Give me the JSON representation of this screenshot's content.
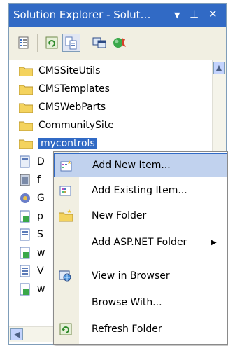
{
  "titlebar": {
    "title": "Solution Explorer - Solut…",
    "dropdown": "▼",
    "pin": "⊥",
    "close": "✕"
  },
  "toolbar": {
    "buttons": [
      "properties-icon",
      "refresh-icon",
      "show-all-files-icon",
      "copy-website-icon",
      "asp-config-icon"
    ]
  },
  "tree": {
    "items": [
      {
        "label": "CMSSiteUtils"
      },
      {
        "label": "CMSTemplates"
      },
      {
        "label": "CMSWebParts"
      },
      {
        "label": "CommunitySite"
      },
      {
        "label": "mycontrols"
      }
    ],
    "partial_items": [
      "D",
      "f",
      "G",
      "p",
      "S",
      "w",
      "V",
      "w"
    ]
  },
  "context_menu": {
    "items": [
      {
        "label": "Add New Item...",
        "icon": "add-new-item-icon"
      },
      {
        "label": "Add Existing Item...",
        "icon": "add-existing-item-icon"
      },
      {
        "label": "New Folder",
        "icon": "new-folder-icon"
      },
      {
        "label": "Add ASP.NET Folder",
        "submenu": "▶"
      },
      {
        "label": "View in Browser",
        "icon": "view-in-browser-icon"
      },
      {
        "label": "Browse With...",
        "icon": ""
      },
      {
        "label": "Refresh Folder",
        "icon": "refresh-icon"
      }
    ]
  },
  "colors": {
    "titlebar": "#316ac5",
    "selection": "#316ac5",
    "menu_highlight": "#c1d2ee",
    "toolbar": "#f1efe2"
  }
}
